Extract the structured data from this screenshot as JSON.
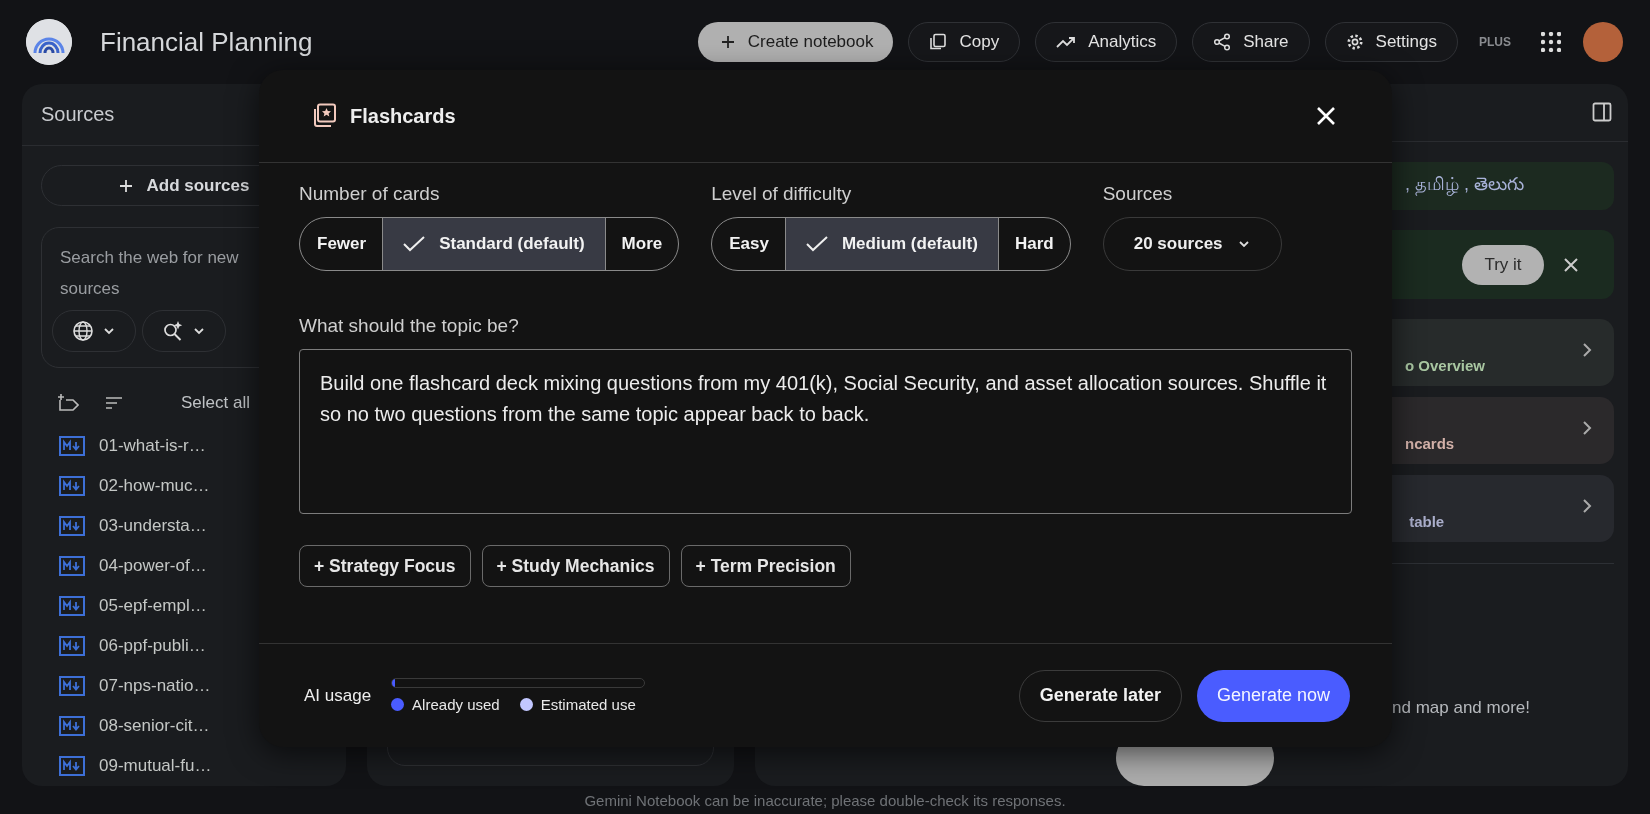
{
  "header": {
    "title": "Financial Planning",
    "buttons": [
      {
        "label": "Create notebook",
        "kind": "primary"
      },
      {
        "label": "Copy",
        "kind": "outline"
      },
      {
        "label": "Analytics",
        "kind": "outline"
      },
      {
        "label": "Share",
        "kind": "outline"
      },
      {
        "label": "Settings",
        "kind": "outline"
      }
    ],
    "plan_badge": "PLUS"
  },
  "sources_panel": {
    "title": "Sources",
    "add_button": "Add sources",
    "search": {
      "placeholder": "Search the web for new sources"
    },
    "select_all": "Select all",
    "items": [
      "01-what-is-r…",
      "02-how-muc…",
      "03-understa…",
      "04-power-of…",
      "05-epf-empl…",
      "06-ppf-publi…",
      "07-nps-natio…",
      "08-senior-cit…",
      "09-mutual-fu…"
    ]
  },
  "studio_panel": {
    "banner_text": ", தமிழ் , తెలుగు",
    "promo_button": "Try it",
    "cards": [
      {
        "subtitle": "o Overview",
        "color": "#a9c7a2"
      },
      {
        "subtitle": "ncards",
        "color": "#d3b1a9"
      },
      {
        "subtitle": " table",
        "color": "#aaaecb"
      }
    ],
    "hint": "nd map and more!"
  },
  "dialog": {
    "title": "Flashcards",
    "groups": [
      {
        "label": "Number of cards",
        "options": [
          {
            "label": "Fewer",
            "selected": false
          },
          {
            "label": "Standard (default)",
            "selected": true
          },
          {
            "label": "More",
            "selected": false
          }
        ]
      },
      {
        "label": "Level of difficulty",
        "options": [
          {
            "label": "Easy",
            "selected": false
          },
          {
            "label": "Medium (default)",
            "selected": true
          },
          {
            "label": "Hard",
            "selected": false
          }
        ]
      }
    ],
    "sources": {
      "label": "Sources",
      "value": "20 sources"
    },
    "topic": {
      "label": "What should the topic be?",
      "value": "Build one flashcard deck mixing questions from my 401(k), Social Security, and asset allocation sources. Shuffle it so no two questions from the same topic appear back to back."
    },
    "chips": [
      "+ Strategy Focus",
      "+ Study Mechanics",
      "+ Term Precision"
    ],
    "usage": {
      "label": "AI usage",
      "level": 0.01,
      "legend": [
        {
          "label": "Already used",
          "color": "#4a5cff"
        },
        {
          "label": "Estimated use",
          "color": "#c2c7ff"
        }
      ]
    },
    "buttons": [
      {
        "label": "Generate later",
        "kind": "secondary"
      },
      {
        "label": "Generate now",
        "kind": "primary"
      }
    ]
  },
  "notice": "Gemini Notebook can be inaccurate; please double-check its responses."
}
